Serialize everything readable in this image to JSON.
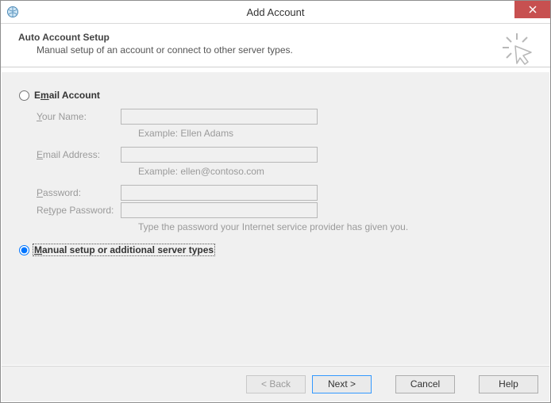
{
  "window": {
    "title": "Add Account"
  },
  "header": {
    "title": "Auto Account Setup",
    "subtitle": "Manual setup of an account or connect to other server types."
  },
  "options": {
    "email_account": {
      "label_pre": "E",
      "label_u": "m",
      "label_post": "ail Account",
      "selected": false
    },
    "manual": {
      "label_pre": "",
      "label_u": "M",
      "label_post": "anual setup or additional server types",
      "selected": true
    }
  },
  "fields": {
    "your_name": {
      "label_pre": "",
      "label_u": "Y",
      "label_post": "our Name:",
      "value": "",
      "hint": "Example: Ellen Adams"
    },
    "email": {
      "label_pre": "",
      "label_u": "E",
      "label_post": "mail Address:",
      "value": "",
      "hint": "Example: ellen@contoso.com"
    },
    "password": {
      "label_pre": "",
      "label_u": "P",
      "label_post": "assword:",
      "value": ""
    },
    "retype": {
      "label_pre": "Re",
      "label_u": "t",
      "label_post": "ype Password:",
      "value": "",
      "hint": "Type the password your Internet service provider has given you."
    }
  },
  "buttons": {
    "back": "< Back",
    "next": "Next >",
    "cancel": "Cancel",
    "help": "Help"
  }
}
